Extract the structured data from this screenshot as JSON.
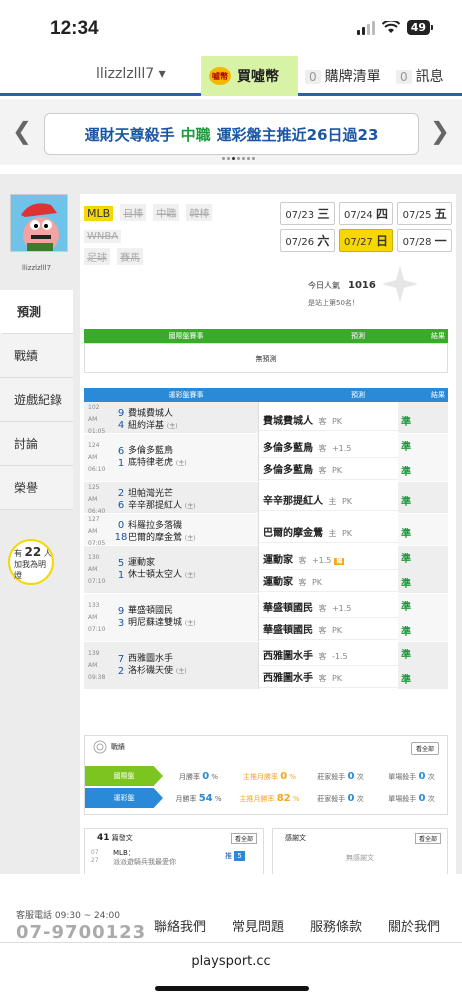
{
  "status": {
    "time": "12:34",
    "battery": "49"
  },
  "topnav": {
    "username": "llizzlzlll7 ▾",
    "coin_label": "買噓幣",
    "coin_icon": "噓幣",
    "orders_count": "0",
    "orders_label": "購牌清單",
    "msg_count": "0",
    "msg_label": "訊息"
  },
  "banner": {
    "t1": "運財天尊殺手",
    "t2": "中職",
    "t3": "運彩盤主推近26日過23"
  },
  "sidebar": {
    "username": "llizzlzlll7",
    "menu": [
      "預測",
      "戰績",
      "遊戲紀錄",
      "討論",
      "榮譽"
    ],
    "likes_pre": "有",
    "likes": "22",
    "likes_unit": "人",
    "likes_text": "加我為明燈"
  },
  "leagues": [
    "MLB",
    "日棒",
    "中職",
    "韓棒",
    "WNBA",
    "足球",
    "賽馬"
  ],
  "dates": [
    {
      "d": "07/23",
      "w": "三"
    },
    {
      "d": "07/24",
      "w": "四"
    },
    {
      "d": "07/25",
      "w": "五"
    },
    {
      "d": "07/26",
      "w": "六"
    },
    {
      "d": "07/27",
      "w": "日"
    },
    {
      "d": "07/28",
      "w": "一"
    }
  ],
  "popularity": {
    "label": "今日人氣",
    "value": "1016",
    "rank": "是站上第50名！"
  },
  "intl": {
    "h1": "國際盤賽事",
    "h2": "預測",
    "h3": "結果",
    "empty": "無預測"
  },
  "lottery": {
    "h1": "運彩盤賽事",
    "h2": "預測",
    "h3": "結果"
  },
  "games": [
    {
      "id": "102",
      "time": "AM 01:05",
      "s1": "9",
      "t1": "費城費城人",
      "s2": "4",
      "t2": "紐約洋基",
      "picks": [
        {
          "team": "費城費城人",
          "side": "客",
          "line": "PK"
        }
      ],
      "res": [
        "準"
      ]
    },
    {
      "id": "124",
      "time": "AM 06:10",
      "s1": "6",
      "t1": "多倫多藍鳥",
      "s2": "1",
      "t2": "底特律老虎",
      "picks": [
        {
          "team": "多倫多藍鳥",
          "side": "客",
          "line": "+1.5"
        },
        {
          "team": "多倫多藍鳥",
          "side": "客",
          "line": "PK"
        }
      ],
      "res": [
        "準",
        "準"
      ]
    },
    {
      "id": "125",
      "time": "AM 06:40",
      "s1": "2",
      "t1": "坦帕灣光芒",
      "s2": "6",
      "t2": "辛辛那提紅人",
      "picks": [
        {
          "team": "辛辛那提紅人",
          "side": "主",
          "line": "PK"
        }
      ],
      "res": [
        "準"
      ]
    },
    {
      "id": "127",
      "time": "AM 07:05",
      "s1": "0",
      "t1": "科羅拉多落磯",
      "s2": "18",
      "t2": "巴爾的摩金鶯",
      "picks": [
        {
          "team": "巴爾的摩金鶯",
          "side": "主",
          "line": "PK"
        }
      ],
      "res": [
        "準"
      ]
    },
    {
      "id": "130",
      "time": "AM 07:10",
      "s1": "5",
      "t1": "運動家",
      "s2": "1",
      "t2": "休士頓太空人",
      "picks": [
        {
          "team": "運動家",
          "side": "客",
          "line": "+1.5",
          "tag": "獨"
        },
        {
          "team": "運動家",
          "side": "客",
          "line": "PK"
        }
      ],
      "res": [
        "準",
        "準"
      ]
    },
    {
      "id": "133",
      "time": "AM 07:10",
      "s1": "9",
      "t1": "華盛頓國民",
      "s2": "3",
      "t2": "明尼蘇達雙城",
      "picks": [
        {
          "team": "華盛頓國民",
          "side": "客",
          "line": "+1.5"
        },
        {
          "team": "華盛頓國民",
          "side": "客",
          "line": "PK"
        }
      ],
      "res": [
        "準",
        "準"
      ]
    },
    {
      "id": "139",
      "time": "AM 09:38",
      "s1": "7",
      "t1": "西雅圖水手",
      "s2": "2",
      "t2": "洛杉磯天使",
      "picks": [
        {
          "team": "西雅圖水手",
          "side": "客",
          "line": "-1.5"
        },
        {
          "team": "西雅圖水手",
          "side": "客",
          "line": "PK"
        }
      ],
      "res": [
        "準",
        "準"
      ]
    }
  ],
  "record": {
    "title": "戰績",
    "all": "看全部",
    "rows": [
      {
        "label": "國際盤",
        "color": "#7cc41f",
        "c1": "月勝率",
        "v1": "0",
        "c2": "主推月勝率",
        "v2": "0",
        "c3": "莊家殺手",
        "v3": "0",
        "c4": "單場殺手",
        "v4": "0"
      },
      {
        "label": "運彩盤",
        "color": "#2a8ad8",
        "c1": "月勝率",
        "v1": "54",
        "c2": "主推月勝率",
        "v2": "82",
        "c3": "莊家殺手",
        "v3": "0",
        "c4": "單場殺手",
        "v4": "0"
      }
    ]
  },
  "posts": {
    "count": "41",
    "label": "篇發文",
    "all": "看全部",
    "date1": "07",
    "date2": "27",
    "league": "MLB：",
    "text": "派派遊騎兵我最愛你",
    "push": "推",
    "push_count": "5"
  },
  "comments": {
    "label": "感謝文",
    "all": "看全部",
    "empty": "無感謝文"
  },
  "footer": {
    "tel_label": "客服電話 09:30 ~ 24:00",
    "tel": "07-9700123",
    "links": [
      "聯絡我們",
      "常見問題",
      "服務條款",
      "關於我們"
    ],
    "url": "playsport.cc"
  }
}
